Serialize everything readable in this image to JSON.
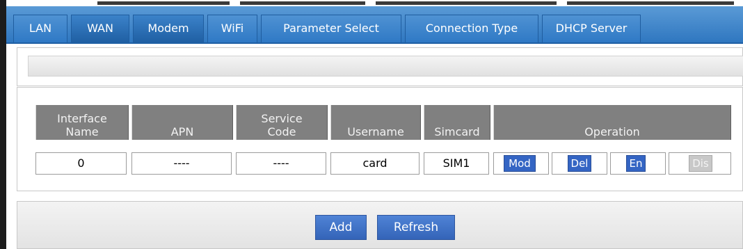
{
  "tabs": [
    {
      "label": "LAN",
      "active": false
    },
    {
      "label": "WAN",
      "active": true
    },
    {
      "label": "Modem",
      "active": true
    },
    {
      "label": "WiFi",
      "active": false
    },
    {
      "label": "Parameter Select",
      "active": false
    },
    {
      "label": "Connection Type",
      "active": false
    },
    {
      "label": "DHCP Server",
      "active": false
    }
  ],
  "table": {
    "headers": {
      "interface_line1": "Interface",
      "interface_line2": "Name",
      "apn": "APN",
      "service_line1": "Service",
      "service_line2": "Code",
      "username": "Username",
      "simcard": "Simcard",
      "operation": "Operation"
    },
    "row": {
      "interface": "0",
      "apn": "----",
      "service": "----",
      "username": "card",
      "simcard": "SIM1",
      "ops": {
        "mod": "Mod",
        "del": "Del",
        "en": "En",
        "dis": "Dis"
      }
    }
  },
  "actions": {
    "add": "Add",
    "refresh": "Refresh"
  },
  "colors": {
    "tab_bar": "#2f77c0",
    "header": "#808080",
    "button": "#3465c4"
  }
}
